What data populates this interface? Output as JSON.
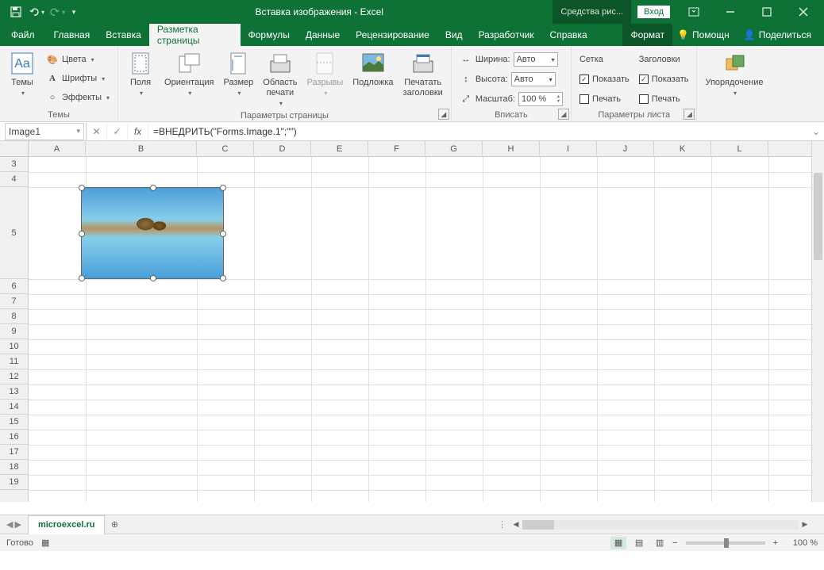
{
  "title": "Вставка изображения  -  Excel",
  "context_tool": "Средства рис...",
  "login": "Вход",
  "tabs": {
    "file": "Файл",
    "home": "Главная",
    "insert": "Вставка",
    "pagelayout": "Разметка страницы",
    "formulas": "Формулы",
    "data": "Данные",
    "review": "Рецензирование",
    "view": "Вид",
    "developer": "Разработчик",
    "help": "Справка",
    "format": "Формат"
  },
  "menu_right": {
    "tell": "Помощн",
    "share": "Поделиться"
  },
  "ribbon": {
    "themes": {
      "btn": "Темы",
      "colors": "Цвета",
      "fonts": "Шрифты",
      "effects": "Эффекты",
      "label": "Темы"
    },
    "pagesetup": {
      "margins": "Поля",
      "orientation": "Ориентация",
      "size": "Размер",
      "printarea": "Область\nпечати",
      "breaks": "Разрывы",
      "background": "Подложка",
      "printtitles": "Печатать\nзаголовки",
      "label": "Параметры страницы"
    },
    "scale": {
      "width_lbl": "Ширина:",
      "width_val": "Авто",
      "height_lbl": "Высота:",
      "height_val": "Авто",
      "scale_lbl": "Масштаб:",
      "scale_val": "100 %",
      "label": "Вписать"
    },
    "sheetopts": {
      "grid": "Сетка",
      "headings": "Заголовки",
      "show": "Показать",
      "print": "Печать",
      "label": "Параметры листа"
    },
    "arrange": {
      "btn": "Упорядочение",
      "label": ""
    }
  },
  "namebox": "Image1",
  "formula": "=ВНЕДРИТЬ(\"Forms.Image.1\";\"\")",
  "columns": [
    "A",
    "B",
    "C",
    "D",
    "E",
    "F",
    "G",
    "H",
    "I",
    "J",
    "K",
    "L"
  ],
  "rows": [
    "3",
    "4",
    "5",
    "6",
    "7",
    "8",
    "9",
    "10",
    "11",
    "12",
    "13",
    "14",
    "15",
    "16",
    "17",
    "18",
    "19"
  ],
  "sheet": "microexcel.ru",
  "status": "Готово",
  "zoom": "100 %"
}
